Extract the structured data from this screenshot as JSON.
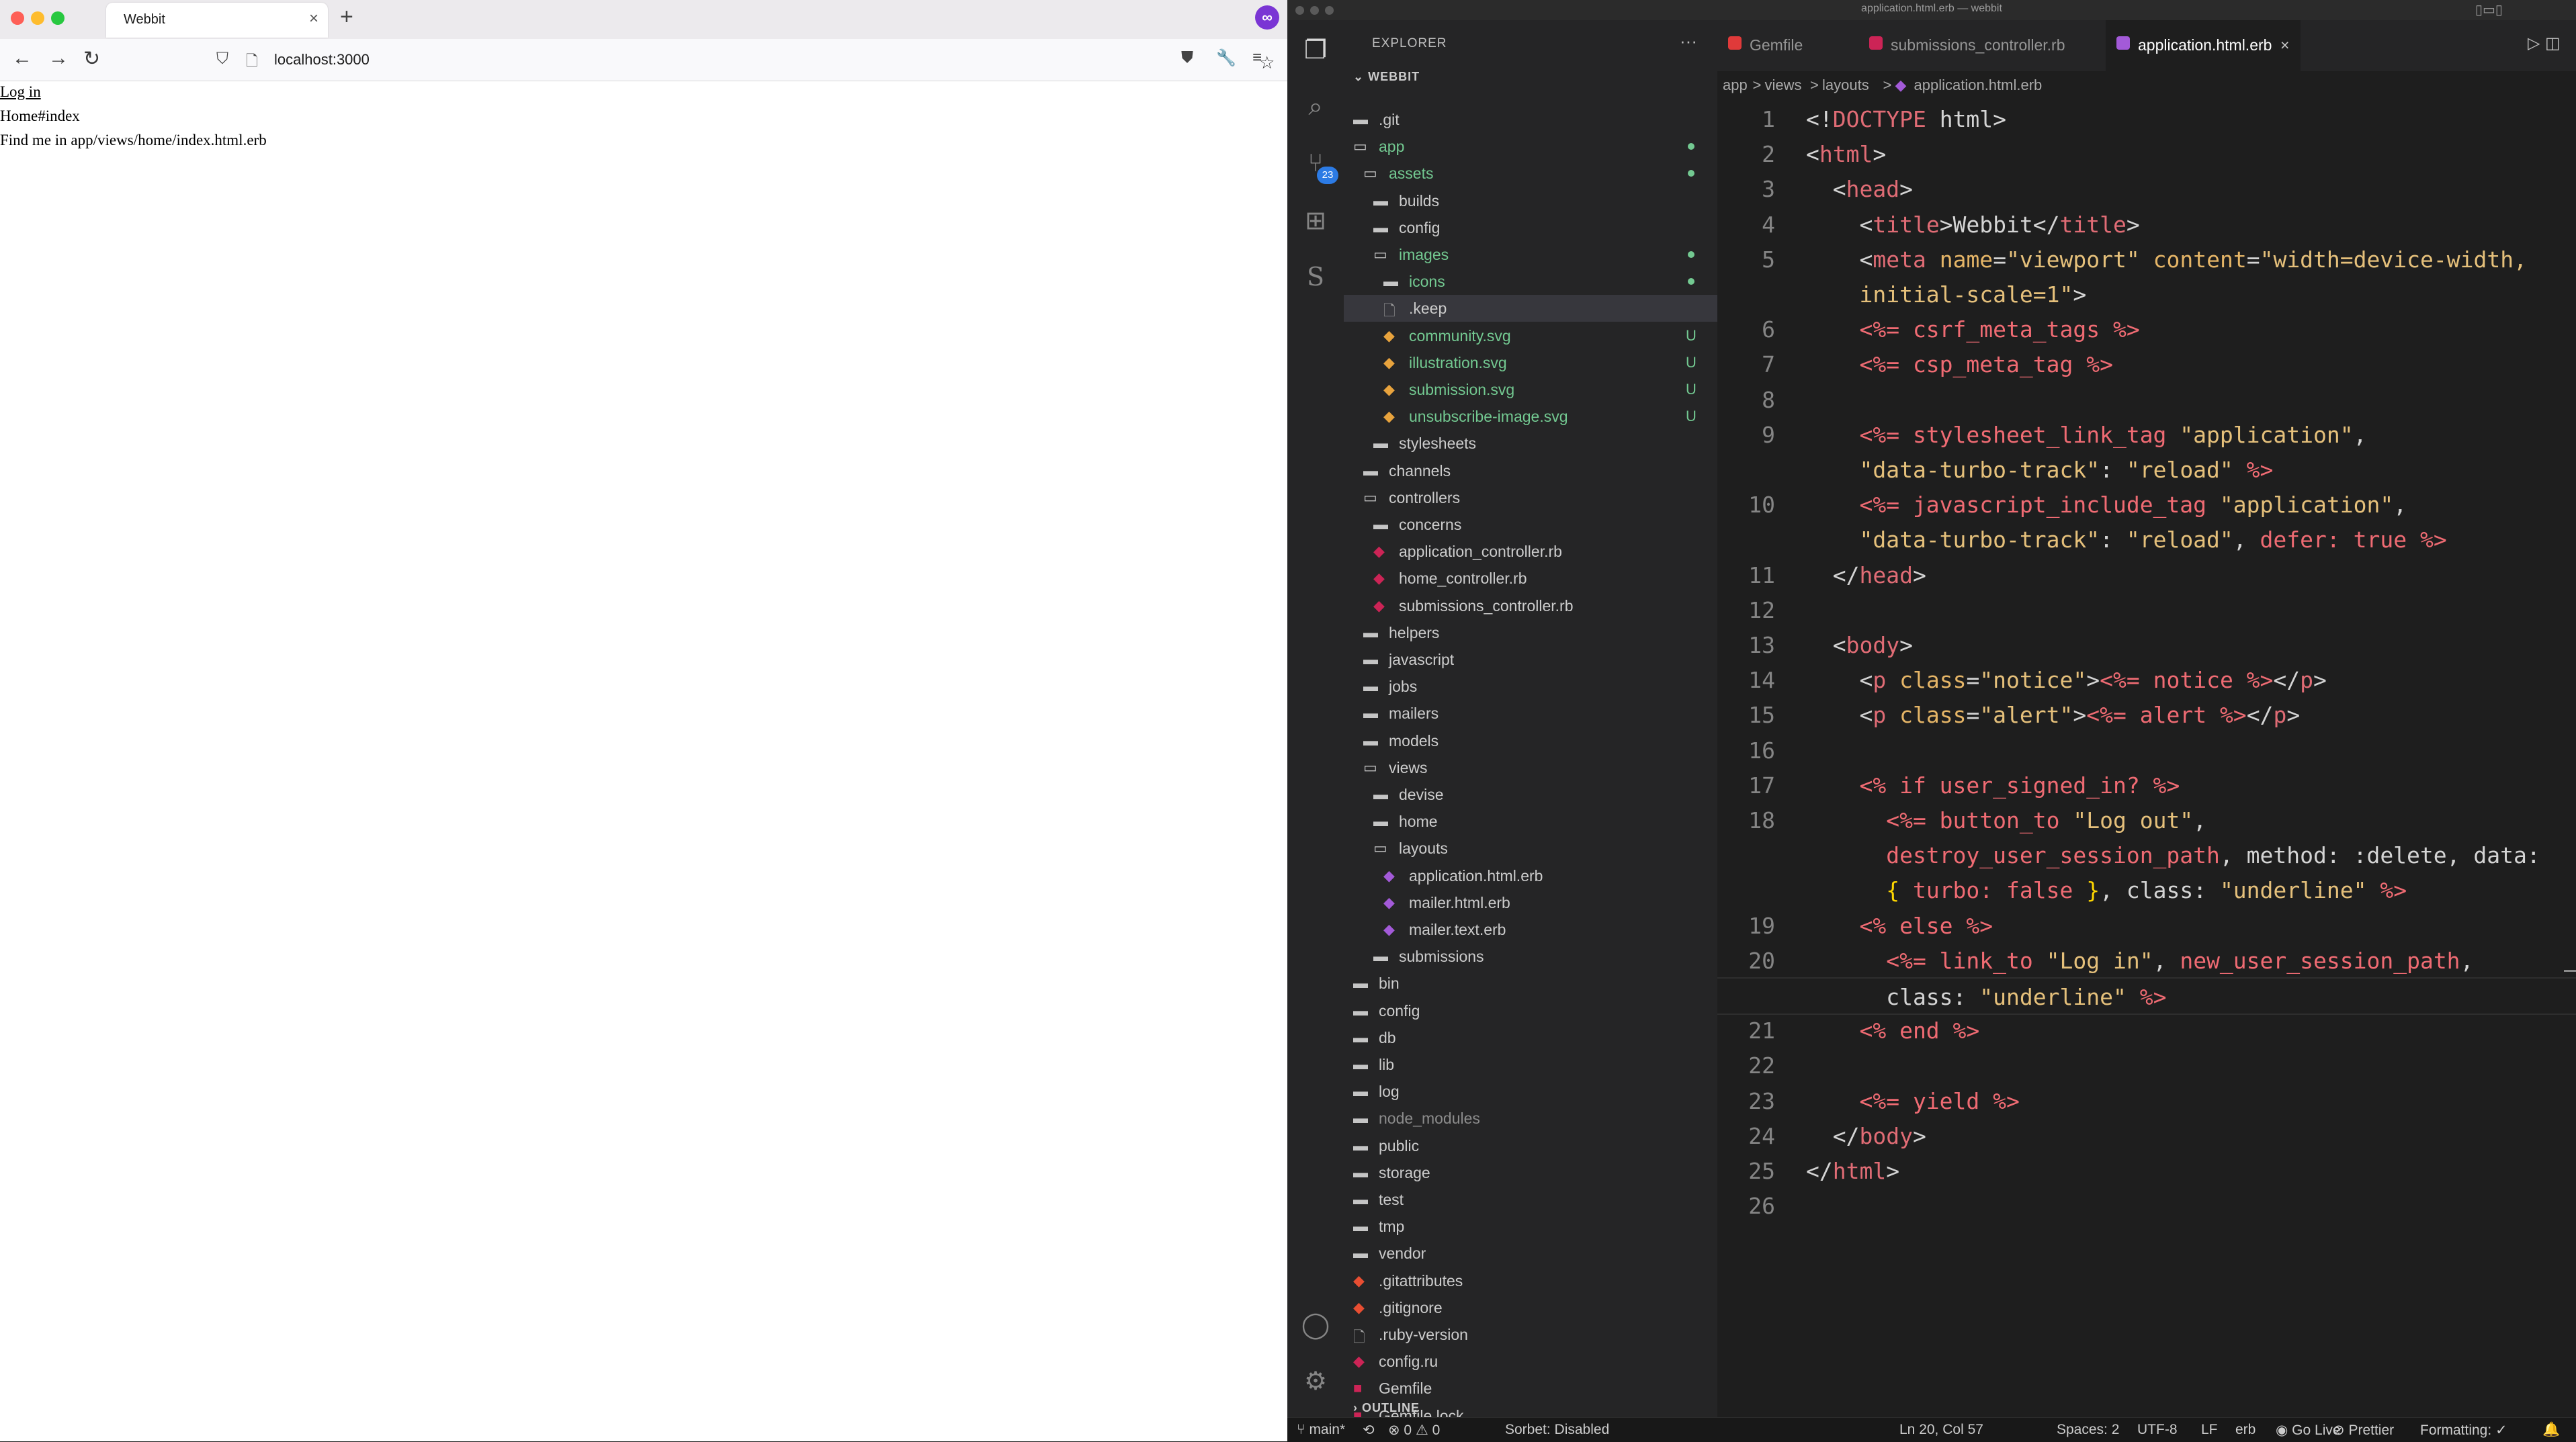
{
  "browser": {
    "tab_title": "Webbit",
    "tab_close": "×",
    "new_tab": "+",
    "ext_icon_label": "∞",
    "url": "localhost:3000",
    "page_lines": [
      "Log in",
      "Home#index",
      "Find me in app/views/home/index.html.erb"
    ]
  },
  "vscode": {
    "window_title": "application.html.erb — webbit",
    "explorer_title": "EXPLORER",
    "explorer_more": "···",
    "workspace": "WEBBIT",
    "outline": "OUTLINE",
    "scm_badge": "23",
    "tree": [
      {
        "label": ".git",
        "depth": 0,
        "kind": "folder"
      },
      {
        "label": "app",
        "depth": 0,
        "kind": "folder-open",
        "status": "untracked",
        "marker": "dot"
      },
      {
        "label": "assets",
        "depth": 1,
        "kind": "folder-open",
        "status": "untracked",
        "marker": "dot"
      },
      {
        "label": "builds",
        "depth": 2,
        "kind": "folder"
      },
      {
        "label": "config",
        "depth": 2,
        "kind": "folder"
      },
      {
        "label": "images",
        "depth": 2,
        "kind": "folder-open",
        "status": "untracked",
        "marker": "dot"
      },
      {
        "label": "icons",
        "depth": 3,
        "kind": "folder",
        "status": "untracked",
        "marker": "dot"
      },
      {
        "label": ".keep",
        "depth": 3,
        "kind": "file",
        "selected": true
      },
      {
        "label": "community.svg",
        "depth": 3,
        "kind": "svg",
        "status": "untracked",
        "marker": "U"
      },
      {
        "label": "illustration.svg",
        "depth": 3,
        "kind": "svg",
        "status": "untracked",
        "marker": "U"
      },
      {
        "label": "submission.svg",
        "depth": 3,
        "kind": "svg",
        "status": "untracked",
        "marker": "U"
      },
      {
        "label": "unsubscribe-image.svg",
        "depth": 3,
        "kind": "svg",
        "status": "untracked",
        "marker": "U"
      },
      {
        "label": "stylesheets",
        "depth": 2,
        "kind": "folder"
      },
      {
        "label": "channels",
        "depth": 1,
        "kind": "folder"
      },
      {
        "label": "controllers",
        "depth": 1,
        "kind": "folder-open"
      },
      {
        "label": "concerns",
        "depth": 2,
        "kind": "folder"
      },
      {
        "label": "application_controller.rb",
        "depth": 2,
        "kind": "ruby"
      },
      {
        "label": "home_controller.rb",
        "depth": 2,
        "kind": "ruby"
      },
      {
        "label": "submissions_controller.rb",
        "depth": 2,
        "kind": "ruby"
      },
      {
        "label": "helpers",
        "depth": 1,
        "kind": "folder"
      },
      {
        "label": "javascript",
        "depth": 1,
        "kind": "folder"
      },
      {
        "label": "jobs",
        "depth": 1,
        "kind": "folder"
      },
      {
        "label": "mailers",
        "depth": 1,
        "kind": "folder"
      },
      {
        "label": "models",
        "depth": 1,
        "kind": "folder"
      },
      {
        "label": "views",
        "depth": 1,
        "kind": "folder-open"
      },
      {
        "label": "devise",
        "depth": 2,
        "kind": "folder"
      },
      {
        "label": "home",
        "depth": 2,
        "kind": "folder"
      },
      {
        "label": "layouts",
        "depth": 2,
        "kind": "folder-open"
      },
      {
        "label": "application.html.erb",
        "depth": 3,
        "kind": "erb"
      },
      {
        "label": "mailer.html.erb",
        "depth": 3,
        "kind": "erb"
      },
      {
        "label": "mailer.text.erb",
        "depth": 3,
        "kind": "erb"
      },
      {
        "label": "submissions",
        "depth": 2,
        "kind": "folder"
      },
      {
        "label": "bin",
        "depth": 0,
        "kind": "folder"
      },
      {
        "label": "config",
        "depth": 0,
        "kind": "folder"
      },
      {
        "label": "db",
        "depth": 0,
        "kind": "folder"
      },
      {
        "label": "lib",
        "depth": 0,
        "kind": "folder"
      },
      {
        "label": "log",
        "depth": 0,
        "kind": "folder"
      },
      {
        "label": "node_modules",
        "depth": 0,
        "kind": "folder",
        "status": "ignored"
      },
      {
        "label": "public",
        "depth": 0,
        "kind": "folder"
      },
      {
        "label": "storage",
        "depth": 0,
        "kind": "folder"
      },
      {
        "label": "test",
        "depth": 0,
        "kind": "folder"
      },
      {
        "label": "tmp",
        "depth": 0,
        "kind": "folder"
      },
      {
        "label": "vendor",
        "depth": 0,
        "kind": "folder"
      },
      {
        "label": ".gitattributes",
        "depth": 0,
        "kind": "git"
      },
      {
        "label": ".gitignore",
        "depth": 0,
        "kind": "git"
      },
      {
        "label": ".ruby-version",
        "depth": 0,
        "kind": "file"
      },
      {
        "label": "config.ru",
        "depth": 0,
        "kind": "ruby"
      },
      {
        "label": "Gemfile",
        "depth": 0,
        "kind": "gem"
      },
      {
        "label": "Gemfile.lock",
        "depth": 0,
        "kind": "gem"
      }
    ],
    "tabs": [
      {
        "label": "Gemfile",
        "icon_color": "#e03a3a",
        "active": false
      },
      {
        "label": "submissions_controller.rb",
        "icon_color": "#cc2456",
        "active": false
      },
      {
        "label": "application.html.erb",
        "icon_color": "#a35ad8",
        "active": true,
        "close": "×"
      }
    ],
    "breadcrumb": [
      "app",
      ">",
      "views",
      ">",
      "layouts",
      ">",
      "application.html.erb"
    ],
    "code": [
      {
        "n": "1",
        "lines": [
          [
            [
              "t",
              "<!"
            ],
            [
              "k",
              "DOCTYPE"
            ],
            [
              "t",
              " html>"
            ]
          ]
        ]
      },
      {
        "n": "2",
        "lines": [
          [
            [
              "t",
              "<"
            ],
            [
              "k",
              "html"
            ],
            [
              "t",
              ">"
            ]
          ]
        ]
      },
      {
        "n": "3",
        "lines": [
          [
            [
              "t",
              "  <"
            ],
            [
              "k",
              "head"
            ],
            [
              "t",
              ">"
            ]
          ]
        ]
      },
      {
        "n": "4",
        "lines": [
          [
            [
              "t",
              "    <"
            ],
            [
              "k",
              "title"
            ],
            [
              "t",
              ">Webbit</"
            ],
            [
              "k",
              "title"
            ],
            [
              "t",
              ">"
            ]
          ]
        ]
      },
      {
        "n": "5",
        "lines": [
          [
            [
              "t",
              "    <"
            ],
            [
              "k",
              "meta"
            ],
            [
              "t",
              " "
            ],
            [
              "a",
              "name"
            ],
            [
              "t",
              "="
            ],
            [
              "s",
              "\"viewport\""
            ],
            [
              "t",
              " "
            ],
            [
              "a",
              "content"
            ],
            [
              "t",
              "="
            ],
            [
              "s",
              "\"width=device-width,"
            ]
          ],
          [
            [
              "s",
              "    initial-scale=1\""
            ],
            [
              "t",
              ">"
            ]
          ]
        ]
      },
      {
        "n": "6",
        "lines": [
          [
            [
              "e",
              "    <%= csrf_meta_tags %>"
            ]
          ]
        ]
      },
      {
        "n": "7",
        "lines": [
          [
            [
              "e",
              "    <%= csp_meta_tag %>"
            ]
          ]
        ]
      },
      {
        "n": "8",
        "lines": [
          [
            [
              "t",
              ""
            ]
          ]
        ]
      },
      {
        "n": "9",
        "lines": [
          [
            [
              "e",
              "    <%= stylesheet_link_tag "
            ],
            [
              "s",
              "\"application\""
            ],
            [
              "t",
              ","
            ]
          ],
          [
            [
              "s",
              "    \"data-turbo-track\""
            ],
            [
              "t",
              ": "
            ],
            [
              "s",
              "\"reload\""
            ],
            [
              "e",
              " %>"
            ]
          ]
        ]
      },
      {
        "n": "10",
        "lines": [
          [
            [
              "e",
              "    <%= javascript_include_tag "
            ],
            [
              "s",
              "\"application\""
            ],
            [
              "t",
              ","
            ]
          ],
          [
            [
              "s",
              "    \"data-turbo-track\""
            ],
            [
              "t",
              ": "
            ],
            [
              "s",
              "\"reload\""
            ],
            [
              "t",
              ", "
            ],
            [
              "e",
              "defer: true %>"
            ]
          ]
        ]
      },
      {
        "n": "11",
        "lines": [
          [
            [
              "t",
              "  </"
            ],
            [
              "k",
              "head"
            ],
            [
              "t",
              ">"
            ]
          ]
        ]
      },
      {
        "n": "12",
        "lines": [
          [
            [
              "t",
              ""
            ]
          ]
        ]
      },
      {
        "n": "13",
        "lines": [
          [
            [
              "t",
              "  <"
            ],
            [
              "k",
              "body"
            ],
            [
              "t",
              ">"
            ]
          ]
        ]
      },
      {
        "n": "14",
        "lines": [
          [
            [
              "t",
              "    <"
            ],
            [
              "k",
              "p"
            ],
            [
              "t",
              " "
            ],
            [
              "a",
              "class"
            ],
            [
              "t",
              "="
            ],
            [
              "s",
              "\"notice\""
            ],
            [
              "t",
              ">"
            ],
            [
              "e",
              "<%= notice %>"
            ],
            [
              "t",
              "</"
            ],
            [
              "k",
              "p"
            ],
            [
              "t",
              ">"
            ]
          ]
        ]
      },
      {
        "n": "15",
        "lines": [
          [
            [
              "t",
              "    <"
            ],
            [
              "k",
              "p"
            ],
            [
              "t",
              " "
            ],
            [
              "a",
              "class"
            ],
            [
              "t",
              "="
            ],
            [
              "s",
              "\"alert\""
            ],
            [
              "t",
              ">"
            ],
            [
              "e",
              "<%= alert %>"
            ],
            [
              "t",
              "</"
            ],
            [
              "k",
              "p"
            ],
            [
              "t",
              ">"
            ]
          ]
        ]
      },
      {
        "n": "16",
        "lines": [
          [
            [
              "t",
              ""
            ]
          ]
        ]
      },
      {
        "n": "17",
        "lines": [
          [
            [
              "e",
              "    <% if user_signed_in? %>"
            ]
          ]
        ]
      },
      {
        "n": "18",
        "lines": [
          [
            [
              "e",
              "      <%= button_to "
            ],
            [
              "s",
              "\"Log out\""
            ],
            [
              "t",
              ","
            ]
          ],
          [
            [
              "e",
              "      destroy_user_session_path"
            ],
            [
              "t",
              ", method: :delete, data:"
            ]
          ],
          [
            [
              "y",
              "      { "
            ],
            [
              "e",
              "turbo: false"
            ],
            [
              "y",
              " }"
            ],
            [
              "t",
              ", class: "
            ],
            [
              "s",
              "\"underline\""
            ],
            [
              "e",
              " %>"
            ]
          ]
        ]
      },
      {
        "n": "19",
        "lines": [
          [
            [
              "e",
              "    <% else %>"
            ]
          ]
        ]
      },
      {
        "n": "20",
        "lines": [
          [
            [
              "e",
              "      <%= link_to "
            ],
            [
              "s",
              "\"Log in\""
            ],
            [
              "t",
              ", "
            ],
            [
              "e",
              "new_user_session_path"
            ],
            [
              "t",
              ","
            ]
          ],
          [
            [
              "t",
              "      class: "
            ],
            [
              "s",
              "\"underline\""
            ],
            [
              "e",
              " %>"
            ]
          ]
        ]
      },
      {
        "n": "21",
        "lines": [
          [
            [
              "e",
              "    <% end %>"
            ]
          ]
        ]
      },
      {
        "n": "22",
        "lines": [
          [
            [
              "t",
              ""
            ]
          ]
        ]
      },
      {
        "n": "23",
        "lines": [
          [
            [
              "e",
              "    <%= yield %>"
            ]
          ]
        ]
      },
      {
        "n": "24",
        "lines": [
          [
            [
              "t",
              "  </"
            ],
            [
              "k",
              "body"
            ],
            [
              "t",
              ">"
            ]
          ]
        ]
      },
      {
        "n": "25",
        "lines": [
          [
            [
              "t",
              "</"
            ],
            [
              "k",
              "html"
            ],
            [
              "t",
              ">"
            ]
          ]
        ]
      },
      {
        "n": "26",
        "lines": [
          [
            [
              "t",
              ""
            ]
          ]
        ]
      }
    ],
    "status": {
      "branch": "main*",
      "problems": "⊗ 0 ⚠ 0",
      "sorbet": "Sorbet: Disabled",
      "position": "Ln 20, Col 57",
      "spaces": "Spaces: 2",
      "encoding": "UTF-8",
      "eol": "LF",
      "language": "erb",
      "golive": "Go Live",
      "prettier": "Prettier",
      "formatting": "Formatting: ✓"
    }
  },
  "colors": {
    "tag": "#e06c75",
    "attr": "#e5b567",
    "string": "#e5c07b",
    "erb": "#ef6b73",
    "text": "#d4d4d4",
    "brace": "#ffd700",
    "untracked": "#73c991"
  }
}
